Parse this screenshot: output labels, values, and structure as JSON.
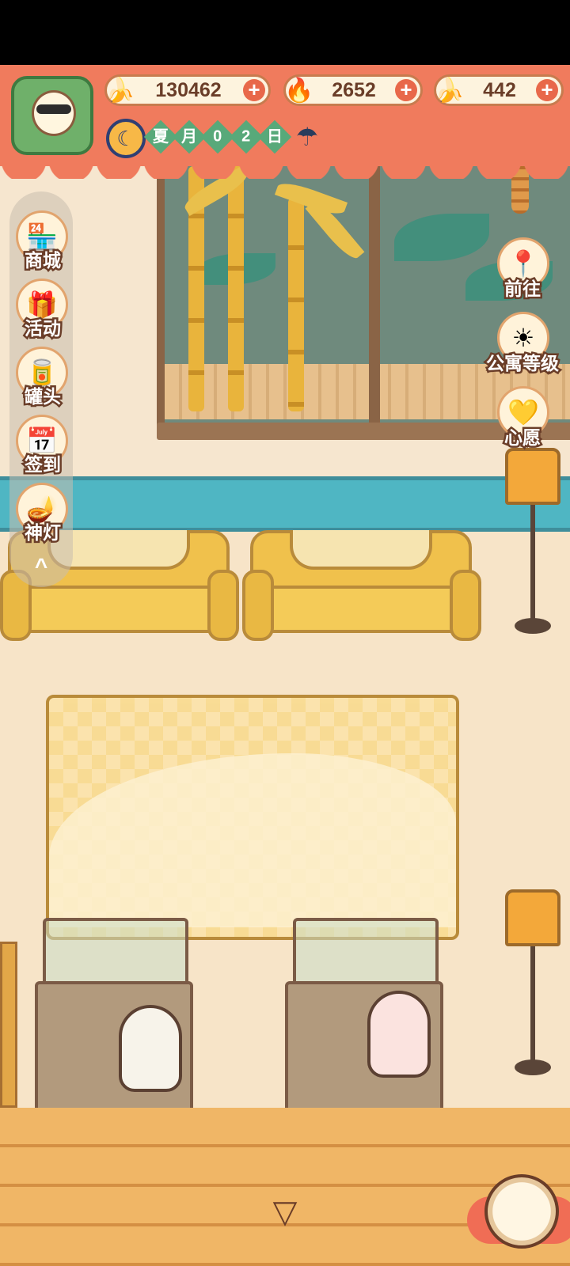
{
  "hud": {
    "currencies": [
      {
        "icon": "banana-icon",
        "glyph": "🍌",
        "value": "130462"
      },
      {
        "icon": "blue-flame-icon",
        "glyph": "🔥",
        "value": "2652"
      },
      {
        "icon": "blue-banana-icon",
        "glyph": "🍌",
        "value": "442"
      }
    ],
    "plus_glyph": "+",
    "date": [
      "夏",
      "月",
      "0",
      "2",
      "日"
    ],
    "clock_glyph": "☾",
    "weather_glyph": "☂"
  },
  "left_menu": [
    {
      "name": "shop",
      "icon": "shop-icon",
      "glyph": "🏪",
      "label": "商城"
    },
    {
      "name": "events",
      "icon": "gift-icon",
      "glyph": "🎁",
      "label": "活动"
    },
    {
      "name": "cans",
      "icon": "can-icon",
      "glyph": "🥫",
      "label": "罐头"
    },
    {
      "name": "checkin",
      "icon": "calendar-icon",
      "glyph": "📅",
      "label": "签到"
    },
    {
      "name": "lamp",
      "icon": "magic-lamp-icon",
      "glyph": "🪔",
      "label": "神灯"
    }
  ],
  "collapse_glyph": "^",
  "right_menu": [
    {
      "name": "goto",
      "icon": "map-pin-icon",
      "glyph": "📍",
      "label": "前往"
    },
    {
      "name": "apartment-level",
      "icon": "sun-cat-icon",
      "glyph": "☀",
      "label": "公寓等级"
    },
    {
      "name": "wish",
      "icon": "heart-book-icon",
      "glyph": "💛",
      "label": "心愿"
    }
  ],
  "bottom": {
    "down_glyph": "▽"
  },
  "colors": {
    "hud_bg": "#f07b5d",
    "stripe": "#4fb6c3",
    "sofa": "#f0c14c"
  }
}
